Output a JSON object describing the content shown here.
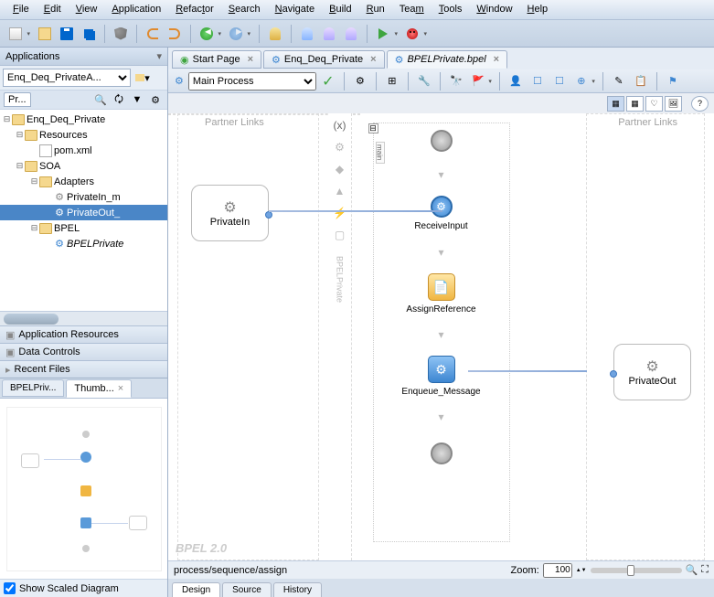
{
  "menu": [
    "File",
    "Edit",
    "View",
    "Application",
    "Refactor",
    "Search",
    "Navigate",
    "Build",
    "Run",
    "Team",
    "Tools",
    "Window",
    "Help"
  ],
  "left": {
    "header": "Applications",
    "combo": "Enq_Deq_PrivateA...",
    "tabs": {
      "projects": "Pr..."
    },
    "tree": {
      "root": "Enq_Deq_Private",
      "resources": "Resources",
      "pom": "pom.xml",
      "soa": "SOA",
      "adapters": "Adapters",
      "privIn": "PrivateIn_m",
      "privOut": "PrivateOut_",
      "bpel": "BPEL",
      "bpelFile": "BPELPrivate"
    },
    "accord": {
      "appres": "Application Resources",
      "data": "Data Controls",
      "recent": "Recent Files"
    },
    "thumbtabs": {
      "overview": "BPELPriv...",
      "thumb": "Thumb..."
    },
    "showScaled": "Show Scaled Diagram"
  },
  "editor": {
    "tabs": {
      "start": "Start Page",
      "enq": "Enq_Deq_Private",
      "bpel": "BPELPrivate.bpel"
    },
    "procCombo": "Main Process",
    "partnerLinks": "Partner Links",
    "mainLabel": "main",
    "bpelprivate": "BPELPrivate",
    "plIn": "PrivateIn",
    "plOut": "PrivateOut",
    "nodes": {
      "recv": "ReceiveInput",
      "assign": "AssignReference",
      "enq": "Enqueue_Message"
    },
    "bpelver": "BPEL 2.0",
    "pathline": "process/sequence/assign",
    "zoomLabel": "Zoom:",
    "zoomVal": "100",
    "bottomTabs": {
      "design": "Design",
      "source": "Source",
      "history": "History"
    }
  }
}
